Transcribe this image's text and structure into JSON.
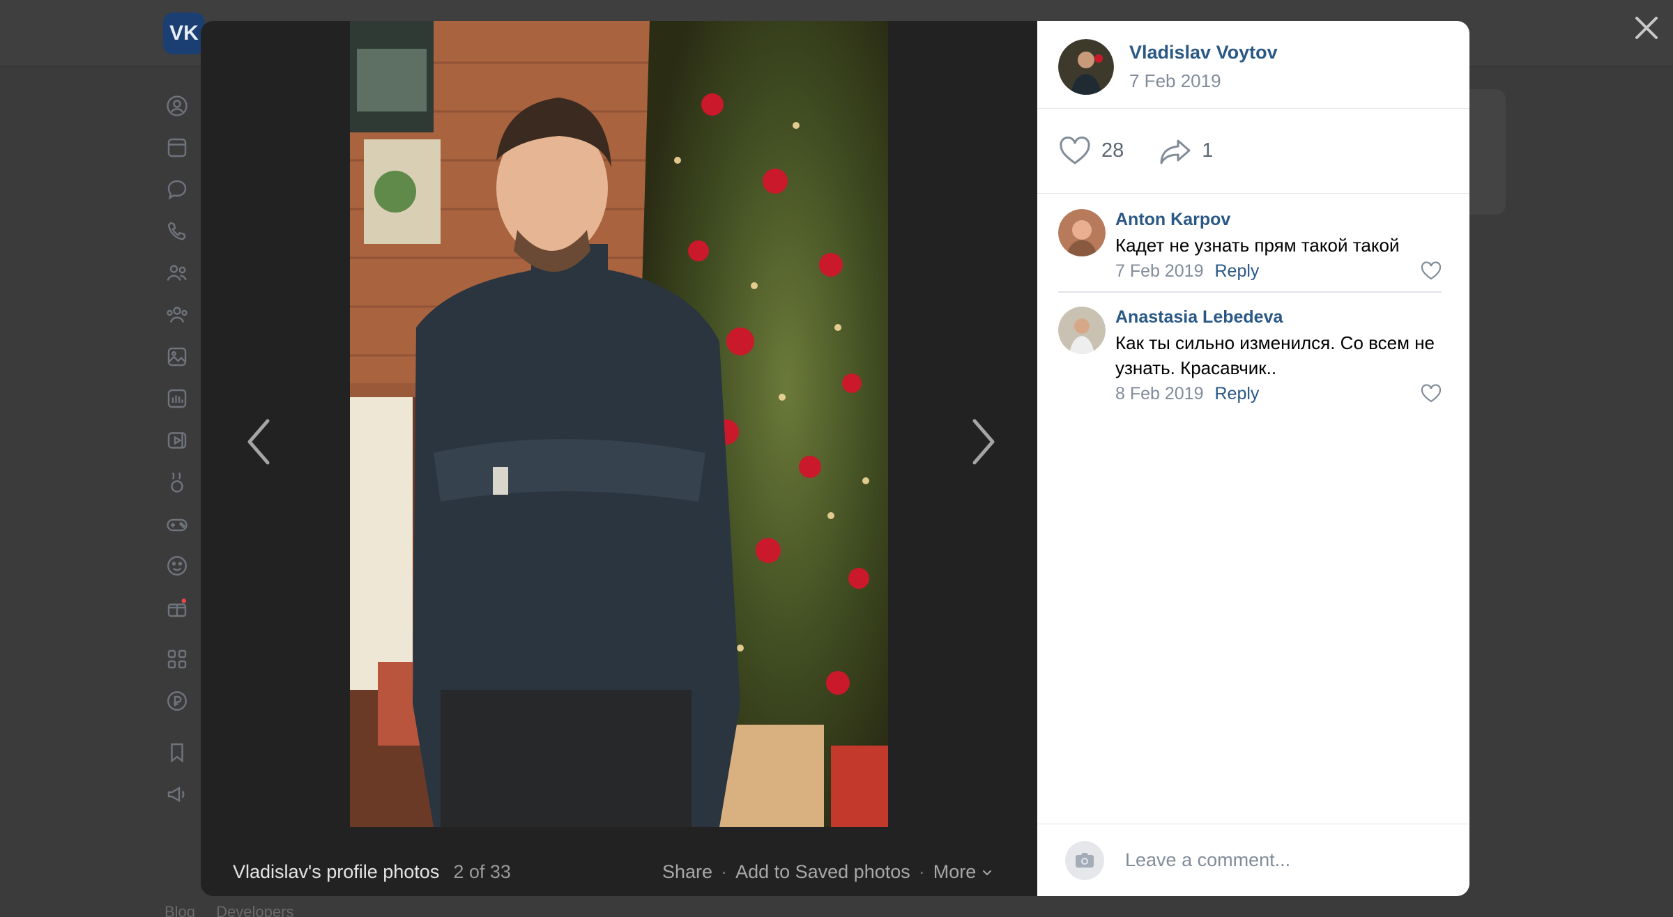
{
  "background": {
    "logo": "VK",
    "rail_icons": [
      "profile-icon",
      "news-icon",
      "messenger-icon",
      "calls-icon",
      "friends-icon",
      "communities-icon",
      "photos-icon",
      "music-icon",
      "videos-icon",
      "clips-icon",
      "games-icon",
      "stickers-icon",
      "gifts-icon",
      "services-icon",
      "payments-icon",
      "bookmarks-icon",
      "ads-icon"
    ],
    "footer_links": [
      "Blog",
      "Developers"
    ]
  },
  "viewer": {
    "album_title": "Vladislav's profile photos",
    "counter": "2 of 33",
    "actions": {
      "share": "Share",
      "save": "Add to Saved photos",
      "more": "More"
    }
  },
  "sidebar": {
    "owner": {
      "name": "Vladislav Voytov",
      "date": "7 Feb 2019"
    },
    "likes": "28",
    "shares": "1",
    "comments": [
      {
        "author": "Anton Karpov",
        "text": "Кадет не узнать прям такой такой",
        "date": "7 Feb 2019",
        "reply": "Reply"
      },
      {
        "author": "Anastasia Lebedeva",
        "text": "Как ты сильно изменился. Со всем не узнать. Красавчик..",
        "date": "8 Feb 2019",
        "reply": "Reply"
      }
    ],
    "comment_placeholder": "Leave a comment..."
  },
  "colors": {
    "link": "#2a5885",
    "muted": "#818c99",
    "overlay": "#3b3b3b"
  }
}
